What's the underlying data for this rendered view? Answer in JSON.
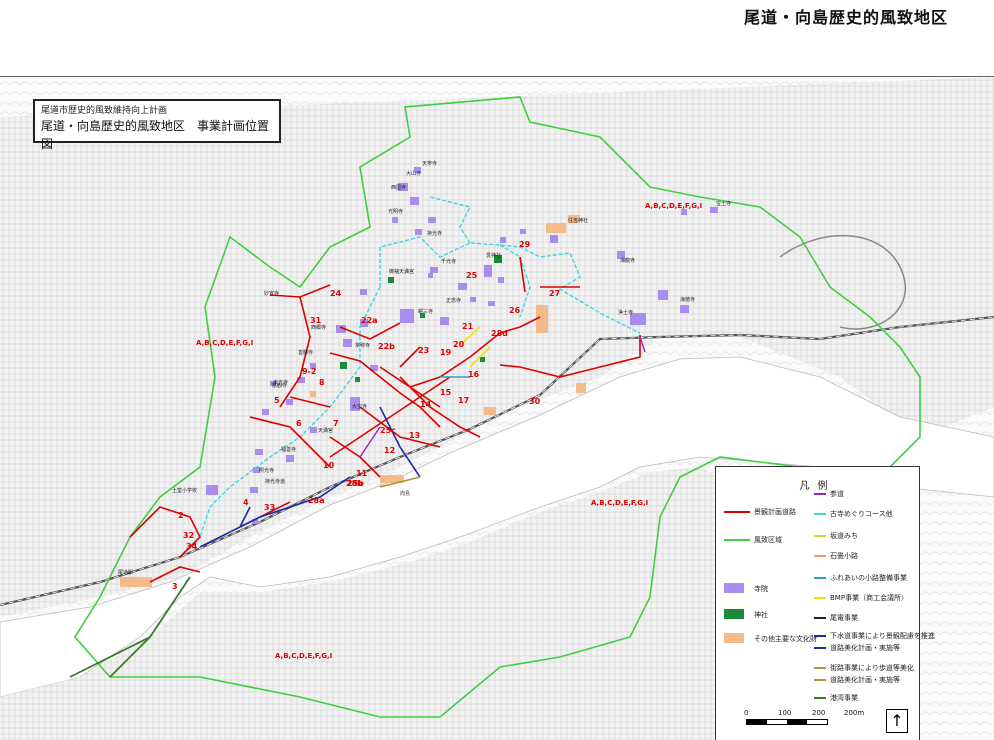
{
  "page_title": "尾道・向島歴史的風致地区",
  "map_title": {
    "subtitle": "尾道市歴史的風致維持向上計画",
    "main": "尾道・向島歴史的風致地区　事業計画位置図"
  },
  "legend": {
    "title": "凡例",
    "items": [
      {
        "label": "景観計画道路",
        "color": "#e00000"
      },
      {
        "label": "風致区域",
        "color": "#3ecf3e"
      },
      {
        "label": "寺院",
        "color": "#a88cf0"
      },
      {
        "label": "神社",
        "color": "#1a8a3a"
      },
      {
        "label": "その他主要な文化財",
        "color": "#f6b98a"
      },
      {
        "label": "参道",
        "color": "#a020c0"
      },
      {
        "label": "古寺めぐりコース他",
        "color": "#3fd6e6"
      },
      {
        "label": "坂道みち",
        "color": "#b8e03a"
      },
      {
        "label": "石畳小路",
        "color": "#e39a66"
      },
      {
        "label": "ふれあいの小路整備事業",
        "color": "#2a9fd6"
      },
      {
        "label": "BMP事業（商工会議所）",
        "color": "#f2e000"
      },
      {
        "label": "尾電事業",
        "color": "#222222"
      },
      {
        "label": "下水道事業により景観配慮を推進",
        "color": "#1a2aa8"
      },
      {
        "label": "道路美化計画・実施等",
        "color": "#1a2aa8"
      },
      {
        "label": "街路事業により歩道等美化",
        "color": "#a89a3a"
      },
      {
        "label": "道路美化計画・実施等",
        "color": "#a89a3a"
      },
      {
        "label": "港湾事業",
        "color": "#3a7a2a"
      }
    ]
  },
  "scale": {
    "ticks": [
      "0",
      "100",
      "200",
      "200m"
    ]
  },
  "area_labels": [
    "A,B,C,D,E,F,G,I",
    "A,B,C,D,E,F,G,I",
    "A,B,C,D,E,F,G,I",
    "A,B,C,D,E,F,G,I"
  ],
  "routes": [
    "2",
    "3",
    "4",
    "5",
    "6",
    "7",
    "8",
    "9-2",
    "10",
    "11",
    "12",
    "13",
    "14",
    "15",
    "16",
    "17",
    "19",
    "20",
    "21",
    "22a",
    "22b",
    "23",
    "24",
    "25",
    "25b",
    "25c",
    "26",
    "27",
    "28a",
    "28b",
    "28d",
    "29",
    "30",
    "31",
    "32",
    "33",
    "34"
  ],
  "pois": [
    "天寧寺",
    "西國寺",
    "浄土寺",
    "海徳寺",
    "持光寺",
    "光明寺",
    "千光寺",
    "西郷寺",
    "常称寺",
    "海龍寺",
    "大山寺",
    "慈観寺",
    "宝土寺",
    "妙宣寺",
    "善勝寺",
    "大宝寺",
    "耕三寺",
    "正念寺",
    "天満宮",
    "福善寺",
    "照光寺",
    "東光寺",
    "艮神社",
    "御袖天満宮",
    "持光寺道",
    "土堂小学校",
    "住吉神社",
    "尾道駅",
    "向島"
  ]
}
